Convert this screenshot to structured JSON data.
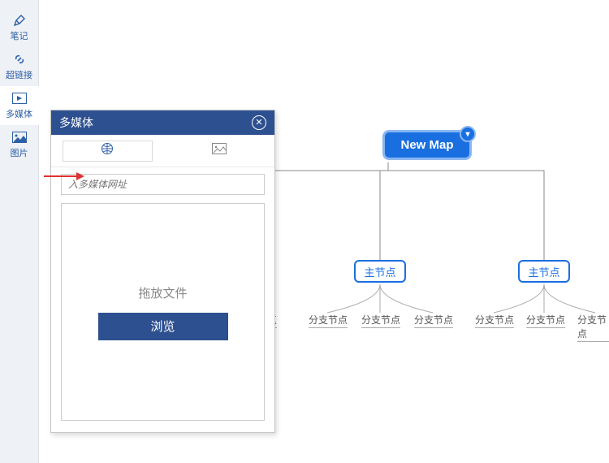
{
  "sidebar": {
    "items": [
      {
        "label": "笔记",
        "icon": "pencil-icon"
      },
      {
        "label": "超链接",
        "icon": "link-icon"
      },
      {
        "label": "多媒体",
        "icon": "media-icon"
      },
      {
        "label": "图片",
        "icon": "image-icon"
      }
    ],
    "active_index": 2
  },
  "panel": {
    "title": "多媒体",
    "close_glyph": "✕",
    "url_placeholder": "入多媒体网址",
    "drop_text": "拖放文件",
    "browse_label": "浏览",
    "tabs": {
      "web": "globe",
      "image": "image",
      "active": "web"
    }
  },
  "mindmap": {
    "root": "New Map",
    "main_nodes": [
      "主节点",
      "主节点"
    ],
    "sub_nodes": [
      "分支节点",
      "分支节点",
      "分支节点",
      "分支节点",
      "分支节点",
      "分支节点"
    ],
    "partial_sub": "点"
  }
}
